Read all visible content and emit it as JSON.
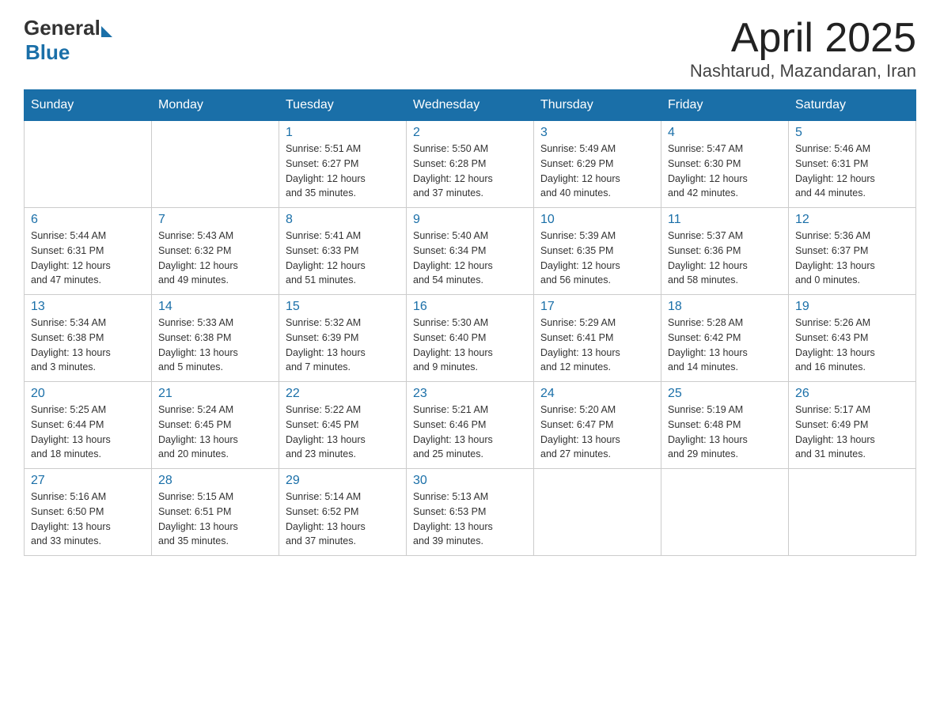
{
  "logo": {
    "general": "General",
    "blue": "Blue"
  },
  "title": "April 2025",
  "subtitle": "Nashtarud, Mazandaran, Iran",
  "days_of_week": [
    "Sunday",
    "Monday",
    "Tuesday",
    "Wednesday",
    "Thursday",
    "Friday",
    "Saturday"
  ],
  "weeks": [
    [
      {
        "day": "",
        "info": ""
      },
      {
        "day": "",
        "info": ""
      },
      {
        "day": "1",
        "info": "Sunrise: 5:51 AM\nSunset: 6:27 PM\nDaylight: 12 hours\nand 35 minutes."
      },
      {
        "day": "2",
        "info": "Sunrise: 5:50 AM\nSunset: 6:28 PM\nDaylight: 12 hours\nand 37 minutes."
      },
      {
        "day": "3",
        "info": "Sunrise: 5:49 AM\nSunset: 6:29 PM\nDaylight: 12 hours\nand 40 minutes."
      },
      {
        "day": "4",
        "info": "Sunrise: 5:47 AM\nSunset: 6:30 PM\nDaylight: 12 hours\nand 42 minutes."
      },
      {
        "day": "5",
        "info": "Sunrise: 5:46 AM\nSunset: 6:31 PM\nDaylight: 12 hours\nand 44 minutes."
      }
    ],
    [
      {
        "day": "6",
        "info": "Sunrise: 5:44 AM\nSunset: 6:31 PM\nDaylight: 12 hours\nand 47 minutes."
      },
      {
        "day": "7",
        "info": "Sunrise: 5:43 AM\nSunset: 6:32 PM\nDaylight: 12 hours\nand 49 minutes."
      },
      {
        "day": "8",
        "info": "Sunrise: 5:41 AM\nSunset: 6:33 PM\nDaylight: 12 hours\nand 51 minutes."
      },
      {
        "day": "9",
        "info": "Sunrise: 5:40 AM\nSunset: 6:34 PM\nDaylight: 12 hours\nand 54 minutes."
      },
      {
        "day": "10",
        "info": "Sunrise: 5:39 AM\nSunset: 6:35 PM\nDaylight: 12 hours\nand 56 minutes."
      },
      {
        "day": "11",
        "info": "Sunrise: 5:37 AM\nSunset: 6:36 PM\nDaylight: 12 hours\nand 58 minutes."
      },
      {
        "day": "12",
        "info": "Sunrise: 5:36 AM\nSunset: 6:37 PM\nDaylight: 13 hours\nand 0 minutes."
      }
    ],
    [
      {
        "day": "13",
        "info": "Sunrise: 5:34 AM\nSunset: 6:38 PM\nDaylight: 13 hours\nand 3 minutes."
      },
      {
        "day": "14",
        "info": "Sunrise: 5:33 AM\nSunset: 6:38 PM\nDaylight: 13 hours\nand 5 minutes."
      },
      {
        "day": "15",
        "info": "Sunrise: 5:32 AM\nSunset: 6:39 PM\nDaylight: 13 hours\nand 7 minutes."
      },
      {
        "day": "16",
        "info": "Sunrise: 5:30 AM\nSunset: 6:40 PM\nDaylight: 13 hours\nand 9 minutes."
      },
      {
        "day": "17",
        "info": "Sunrise: 5:29 AM\nSunset: 6:41 PM\nDaylight: 13 hours\nand 12 minutes."
      },
      {
        "day": "18",
        "info": "Sunrise: 5:28 AM\nSunset: 6:42 PM\nDaylight: 13 hours\nand 14 minutes."
      },
      {
        "day": "19",
        "info": "Sunrise: 5:26 AM\nSunset: 6:43 PM\nDaylight: 13 hours\nand 16 minutes."
      }
    ],
    [
      {
        "day": "20",
        "info": "Sunrise: 5:25 AM\nSunset: 6:44 PM\nDaylight: 13 hours\nand 18 minutes."
      },
      {
        "day": "21",
        "info": "Sunrise: 5:24 AM\nSunset: 6:45 PM\nDaylight: 13 hours\nand 20 minutes."
      },
      {
        "day": "22",
        "info": "Sunrise: 5:22 AM\nSunset: 6:45 PM\nDaylight: 13 hours\nand 23 minutes."
      },
      {
        "day": "23",
        "info": "Sunrise: 5:21 AM\nSunset: 6:46 PM\nDaylight: 13 hours\nand 25 minutes."
      },
      {
        "day": "24",
        "info": "Sunrise: 5:20 AM\nSunset: 6:47 PM\nDaylight: 13 hours\nand 27 minutes."
      },
      {
        "day": "25",
        "info": "Sunrise: 5:19 AM\nSunset: 6:48 PM\nDaylight: 13 hours\nand 29 minutes."
      },
      {
        "day": "26",
        "info": "Sunrise: 5:17 AM\nSunset: 6:49 PM\nDaylight: 13 hours\nand 31 minutes."
      }
    ],
    [
      {
        "day": "27",
        "info": "Sunrise: 5:16 AM\nSunset: 6:50 PM\nDaylight: 13 hours\nand 33 minutes."
      },
      {
        "day": "28",
        "info": "Sunrise: 5:15 AM\nSunset: 6:51 PM\nDaylight: 13 hours\nand 35 minutes."
      },
      {
        "day": "29",
        "info": "Sunrise: 5:14 AM\nSunset: 6:52 PM\nDaylight: 13 hours\nand 37 minutes."
      },
      {
        "day": "30",
        "info": "Sunrise: 5:13 AM\nSunset: 6:53 PM\nDaylight: 13 hours\nand 39 minutes."
      },
      {
        "day": "",
        "info": ""
      },
      {
        "day": "",
        "info": ""
      },
      {
        "day": "",
        "info": ""
      }
    ]
  ]
}
